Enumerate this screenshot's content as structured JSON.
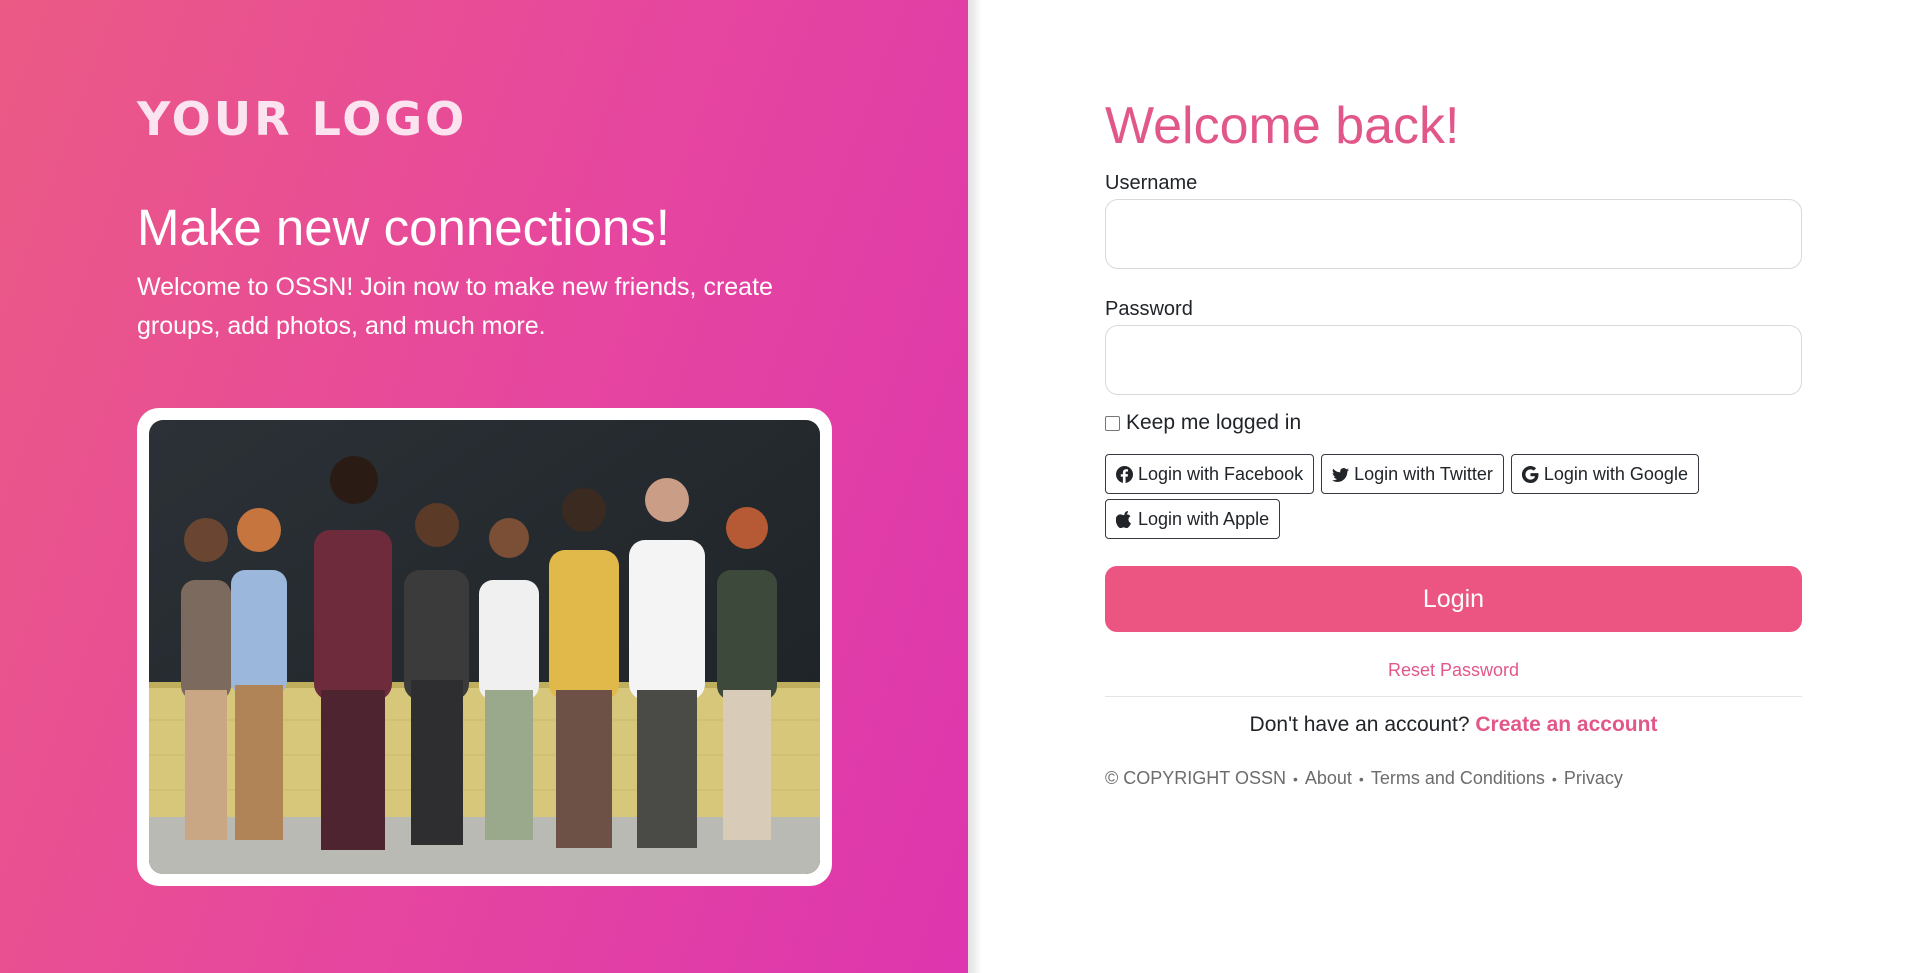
{
  "brand": {
    "logo_text": "YOUR LOGO"
  },
  "hero": {
    "headline": "Make new connections!",
    "description": "Welcome to OSSN! Join now to make new friends, create groups, add photos, and much more."
  },
  "login": {
    "title": "Welcome back!",
    "username_label": "Username",
    "username_value": "",
    "password_label": "Password",
    "password_value": "",
    "remember_label": "Keep me logged in",
    "remember_checked": false,
    "submit_label": "Login",
    "reset_label": "Reset Password"
  },
  "social": [
    {
      "label": "Login with Facebook",
      "icon": "facebook-icon"
    },
    {
      "label": "Login with Twitter",
      "icon": "twitter-icon"
    },
    {
      "label": "Login with Google",
      "icon": "google-icon"
    },
    {
      "label": "Login with Apple",
      "icon": "apple-icon"
    }
  ],
  "signup": {
    "prompt": "Don't have an account?",
    "link_label": "Create an account"
  },
  "footer": {
    "copyright": "© COPYRIGHT OSSN",
    "links": [
      "About",
      "Terms and Conditions",
      "Privacy"
    ]
  },
  "colors": {
    "accent": "#e2578a",
    "button": "#ec5582",
    "gradient_start": "#eb5a85",
    "gradient_end": "#dd36ae"
  }
}
